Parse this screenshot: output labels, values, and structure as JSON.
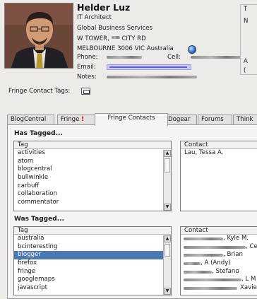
{
  "profile": {
    "name": "Helder Luz",
    "title": "IT Architect",
    "org": "Global Business Services",
    "address1": "W TOWER,",
    "address1b": "CITY RD",
    "address2": "MELBOURNE 3006 VIC Australia",
    "phone_label": "Phone:",
    "cell_label": "Cell:",
    "email_label": "Email:",
    "notes_label": "Notes:"
  },
  "side": {
    "t": "T",
    "n": "N",
    "a": "A",
    "paren": "("
  },
  "fringe_contact_tags_label": "Fringe Contact Tags:",
  "tabs": [
    {
      "label": "BlogCentral"
    },
    {
      "label": "Fringe",
      "badge": "!"
    },
    {
      "label": "Fringe Contacts"
    },
    {
      "label": "Dogear"
    },
    {
      "label": "Forums"
    },
    {
      "label": "Think"
    }
  ],
  "has_tagged": {
    "title": "Has Tagged...",
    "tag_header": "Tag",
    "contact_header": "Contact",
    "tags": [
      "activities",
      "atom",
      "blogcentral",
      "bullwinkle",
      "carbuff",
      "collaboration",
      "commentator"
    ],
    "contacts": [
      "Lau, Tessa A."
    ]
  },
  "was_tagged": {
    "title": "Was Tagged...",
    "tag_header": "Tag",
    "contact_header": "Contact",
    "tags": [
      "australia",
      "bcinteresting",
      "blogger",
      "firefox",
      "fringe",
      "googlemaps",
      "javascript"
    ],
    "selected_tag": "blogger",
    "contacts": [
      ", Kyle M.",
      ", Ce",
      ", Brian",
      ", A (Andy)",
      ", Stefano",
      ", L M",
      "Xavier"
    ]
  },
  "colors": {
    "selection": "#4a78b0",
    "badge": "#cc0000",
    "email_highlight": "#c8c8ff"
  },
  "icons": [
    "globe-icon",
    "tag-icon",
    "scroll-up-icon",
    "scroll-down-icon"
  ]
}
